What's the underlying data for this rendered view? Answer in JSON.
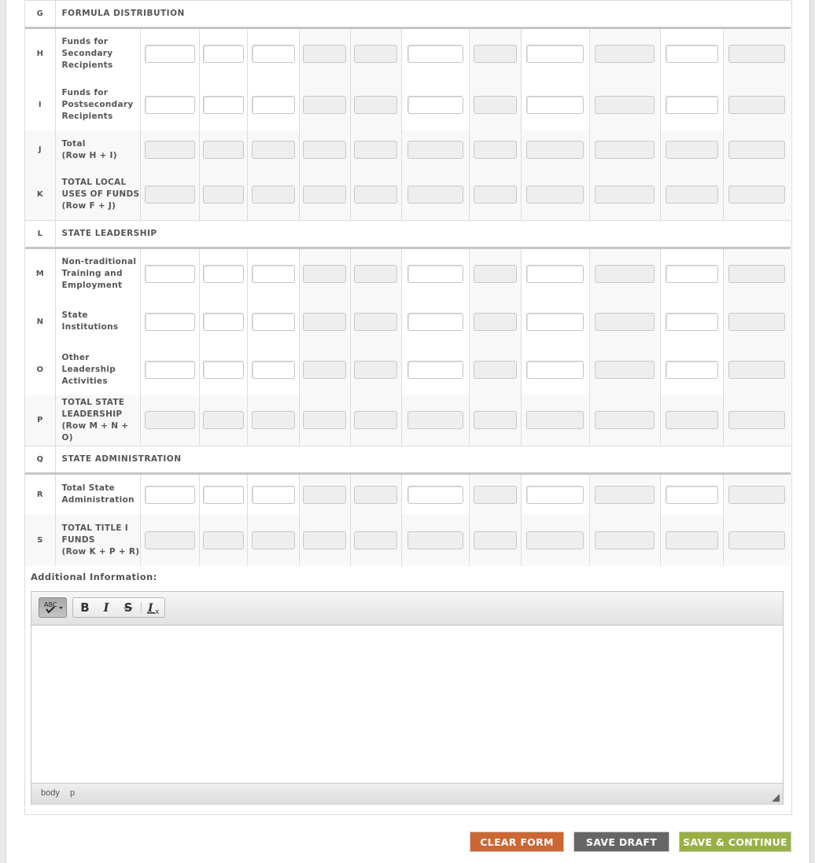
{
  "colors": {
    "clear_button": "#cc6633",
    "draft_button": "#666666",
    "save_button": "#99b045"
  },
  "columns": [
    "c1",
    "c2",
    "c3",
    "c4",
    "c5",
    "c6",
    "c7",
    "c8",
    "c9",
    "c10",
    "c11"
  ],
  "rows": [
    {
      "letter": "G",
      "type": "section",
      "label": "FORMULA DISTRIBUTION"
    },
    {
      "letter": "H",
      "type": "input",
      "label_lines": [
        "Funds for",
        "Secondary",
        "Recipients"
      ]
    },
    {
      "letter": "I",
      "type": "input",
      "label_lines": [
        "Funds for",
        "Postsecondary",
        "Recipients"
      ]
    },
    {
      "letter": "J",
      "type": "total",
      "label_lines": [
        "Total",
        "(Row H + I)"
      ]
    },
    {
      "letter": "K",
      "type": "total",
      "label_lines": [
        "TOTAL LOCAL",
        "USES OF FUNDS",
        "(Row F + J)"
      ]
    },
    {
      "letter": "L",
      "type": "section",
      "label": "STATE LEADERSHIP"
    },
    {
      "letter": "M",
      "type": "input",
      "label_lines": [
        "Non-traditional",
        "Training and",
        "Employment"
      ]
    },
    {
      "letter": "N",
      "type": "input",
      "label_lines": [
        "State",
        "Institutions"
      ]
    },
    {
      "letter": "O",
      "type": "input",
      "label_lines": [
        "Other",
        "Leadership",
        "Activities"
      ]
    },
    {
      "letter": "P",
      "type": "total",
      "label_lines": [
        "TOTAL STATE",
        "LEADERSHIP",
        "(Row M + N + O)"
      ]
    },
    {
      "letter": "Q",
      "type": "section",
      "label": "STATE ADMINISTRATION"
    },
    {
      "letter": "R",
      "type": "input",
      "label_lines": [
        "Total State",
        "Administration"
      ]
    },
    {
      "letter": "S",
      "type": "total",
      "label_lines": [
        "TOTAL TITLE I",
        "FUNDS",
        "(Row K + P + R)"
      ]
    }
  ],
  "editable_columns": [
    true,
    true,
    true,
    false,
    false,
    true,
    false,
    true,
    false,
    true,
    false
  ],
  "additional_info": {
    "label": "Additional Information:",
    "content": "",
    "toolbar": {
      "spellcheck": "ABC✓",
      "bold": "B",
      "italic": "I",
      "strike": "S",
      "remove_format": "Tx"
    },
    "path": [
      "body",
      "p"
    ]
  },
  "buttons": {
    "clear": "CLEAR FORM",
    "draft": "SAVE DRAFT",
    "save": "SAVE & CONTINUE"
  }
}
